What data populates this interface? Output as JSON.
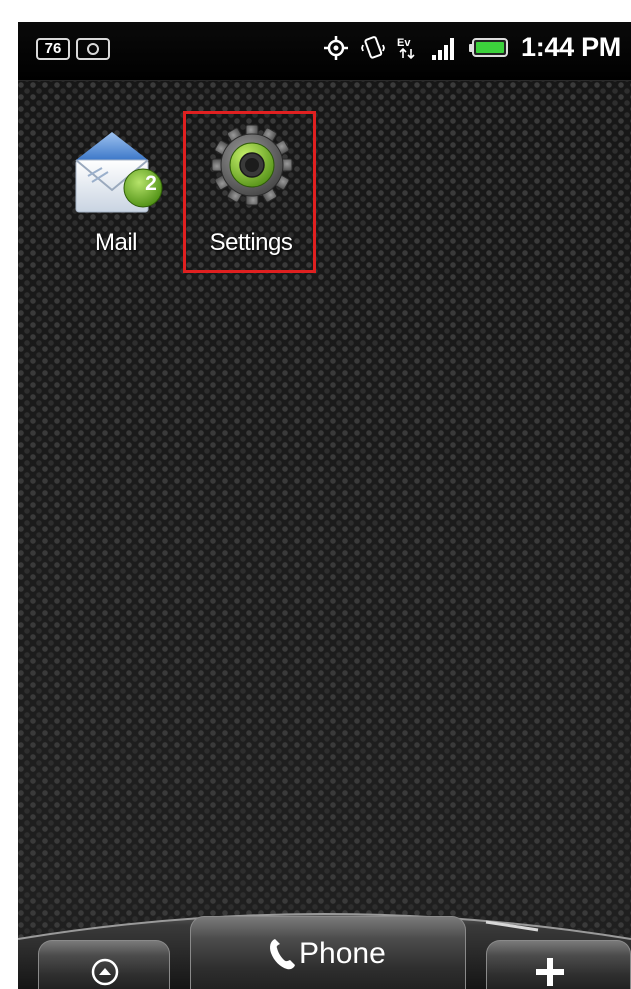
{
  "status_bar": {
    "notification_count": "76",
    "time": "1:44 PM",
    "icons": [
      "notification-count-icon",
      "camera-icon",
      "gps-icon",
      "vibrate-icon",
      "ev-data-icon",
      "signal-icon",
      "battery-icon"
    ]
  },
  "home_screen": {
    "apps": [
      {
        "name": "Mail",
        "icon": "mail-icon",
        "badge": "2"
      },
      {
        "name": "Settings",
        "icon": "gear-icon",
        "highlighted": true
      }
    ]
  },
  "dock": {
    "left_icon": "app-drawer-icon",
    "center_label": "Phone",
    "center_icon": "phone-handset-icon",
    "right_icon": "plus-icon"
  },
  "colors": {
    "highlight": "#e02020",
    "badge_green": "#6fb22a",
    "battery_green": "#3cd13c"
  }
}
